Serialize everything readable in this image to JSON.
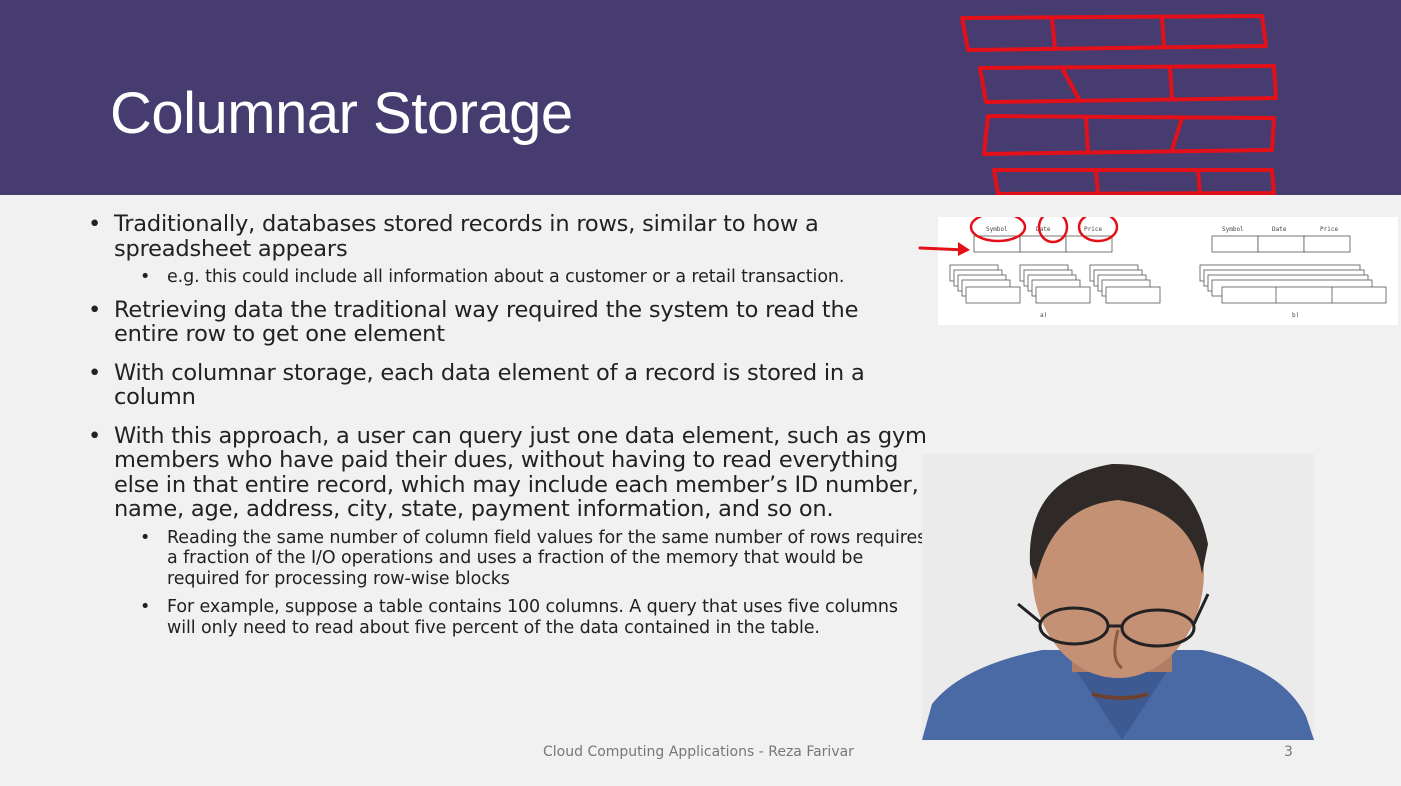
{
  "slide": {
    "title": "Columnar Storage",
    "bullets": [
      {
        "text": "Traditionally, databases stored records in rows, similar to how a spreadsheet appears"
      },
      {
        "text": "e.g. this could include all information about a customer or a retail transaction."
      },
      {
        "text": "Retrieving data the traditional way required the system to read the entire row to get one element"
      },
      {
        "text": "With columnar storage, each data element of a record is stored in a column"
      },
      {
        "text": "With this approach, a user can query just one data element, such as gym members who have paid their dues, without having to read everything else in that entire record, which may include each member’s ID number, name, age, address, city, state, payment information, and so on."
      },
      {
        "text": "Reading the same number of column field values for the same number of rows requires a fraction of the I/O operations and uses a fraction of the memory that would be required for processing row-wise blocks"
      },
      {
        "text": "For example, suppose a table contains 100 columns. A query that uses five columns will only need to read about five percent of the data contained in the table."
      }
    ],
    "footer": "Cloud Computing Applications - Reza Farivar",
    "page_number": "3"
  },
  "diagram": {
    "left": {
      "headers": [
        "Symbol",
        "Date",
        "Price"
      ],
      "caption": "a)"
    },
    "right": {
      "headers": [
        "Symbol",
        "Date",
        "Price"
      ],
      "caption": "b)"
    }
  },
  "colors": {
    "header_bg": "#463c70",
    "annotation": "#e3101a",
    "slide_bg": "#f1f1f1"
  }
}
